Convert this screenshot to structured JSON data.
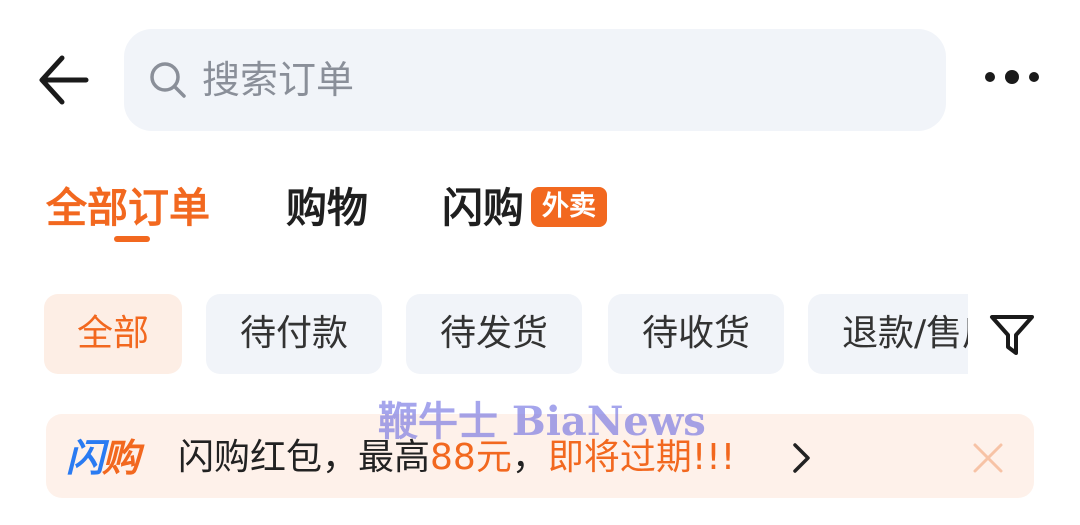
{
  "search": {
    "placeholder": "搜索订单"
  },
  "tabs": [
    {
      "label": "全部订单",
      "active": true
    },
    {
      "label": "购物",
      "active": false
    },
    {
      "label": "闪购",
      "badge": "外卖",
      "active": false
    }
  ],
  "filters": {
    "chips": [
      {
        "label": "全部",
        "active": true
      },
      {
        "label": "待付款",
        "active": false
      },
      {
        "label": "待发货",
        "active": false
      },
      {
        "label": "待收货",
        "active": false
      },
      {
        "label": "退款/售后",
        "active": false
      }
    ]
  },
  "banner": {
    "logo_part1": "闪",
    "logo_part2": "购",
    "text_prefix": "闪购红包，最高",
    "amount": "88元",
    "comma": "，",
    "suffix": "即将过期!!!"
  },
  "watermark": "鞭牛士 BiaNews",
  "icons": {
    "back": "back-arrow-icon",
    "search": "search-icon",
    "more": "more-dots-icon",
    "filter": "filter-icon",
    "chevron": "chevron-right-icon",
    "close": "close-icon"
  },
  "colors": {
    "accent": "#f2681f",
    "chip_bg": "#f1f4f9",
    "chip_active_bg": "#fdeee5",
    "banner_bg": "#fef1ea",
    "logo_blue": "#2a7bf2"
  }
}
